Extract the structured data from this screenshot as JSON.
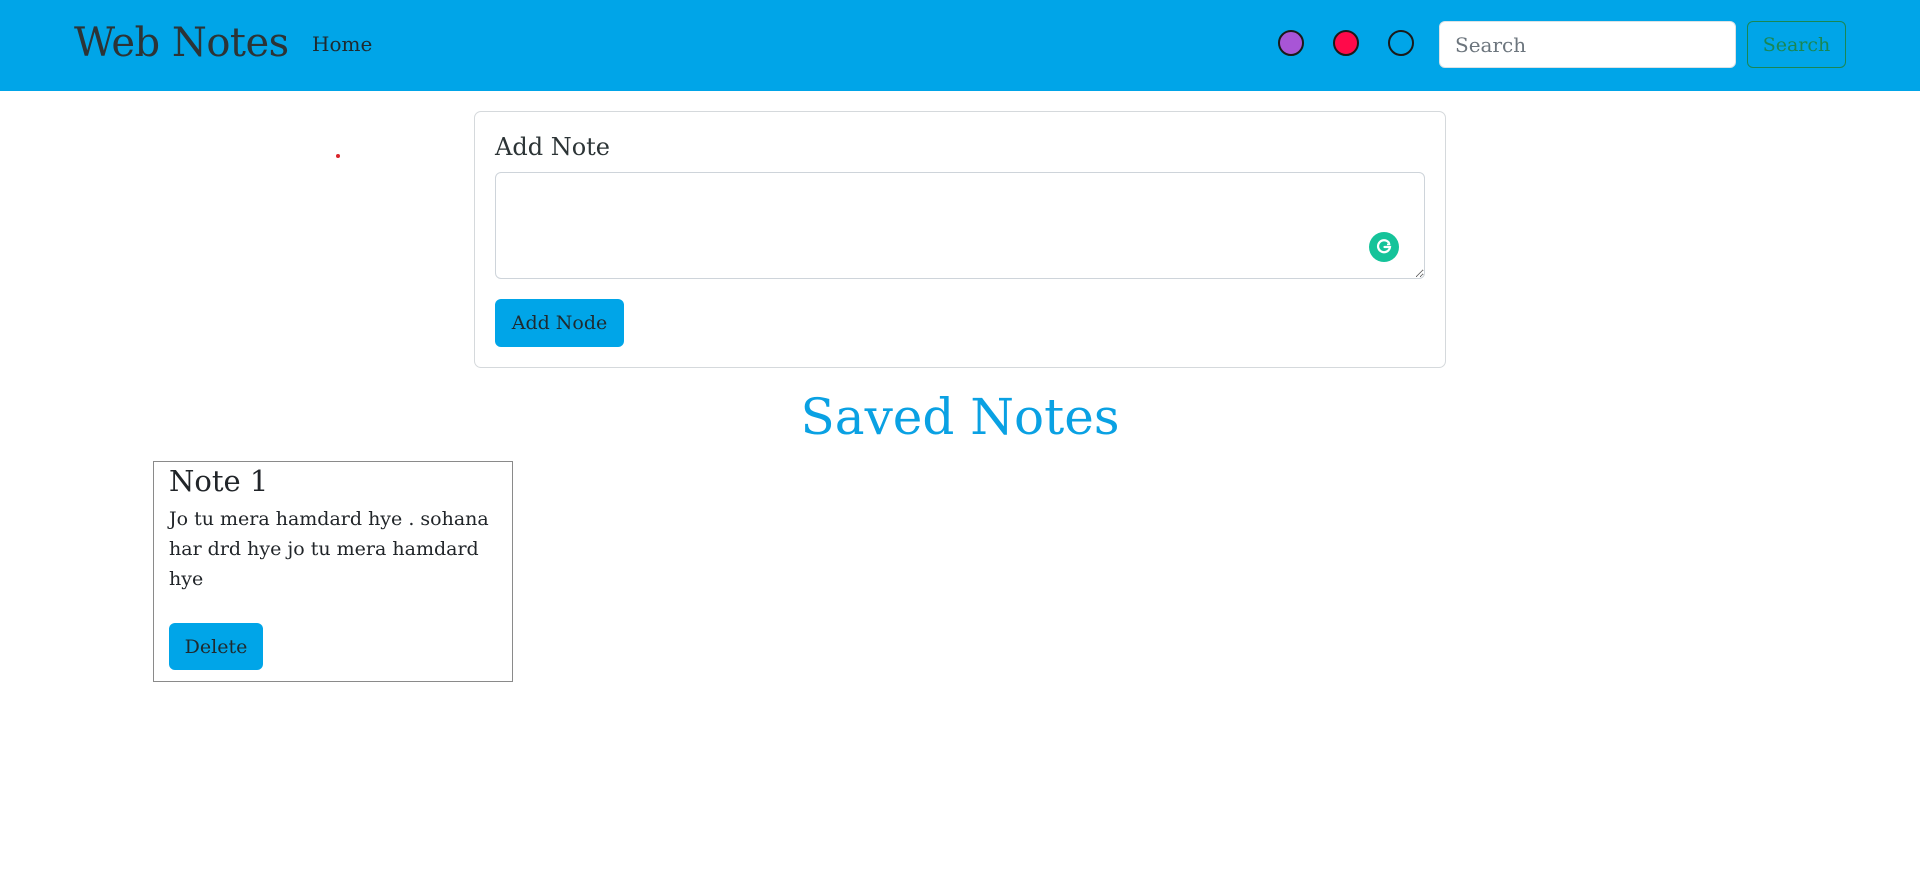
{
  "navbar": {
    "brand": "Web Notes",
    "home_label": "Home",
    "theme_colors": [
      {
        "name": "purple",
        "color": "#a855d6"
      },
      {
        "name": "red",
        "color": "#ff0a4a"
      },
      {
        "name": "blue",
        "color": "#00a5e8"
      }
    ],
    "search": {
      "placeholder": "Search",
      "value": "",
      "button_label": "Search"
    }
  },
  "add_note": {
    "title": "Add Note",
    "textarea_value": "",
    "button_label": "Add Node",
    "grammarly_icon": "grammarly-icon"
  },
  "saved": {
    "heading": "Saved Notes",
    "notes": [
      {
        "title": "Note 1",
        "text": "Jo tu mera hamdard hye . sohana har drd hye jo tu mera hamdard hye",
        "delete_label": "Delete"
      }
    ]
  },
  "colors": {
    "primary": "#00a5e8",
    "heading": "#0aa1e3",
    "search_button": "#198754"
  }
}
